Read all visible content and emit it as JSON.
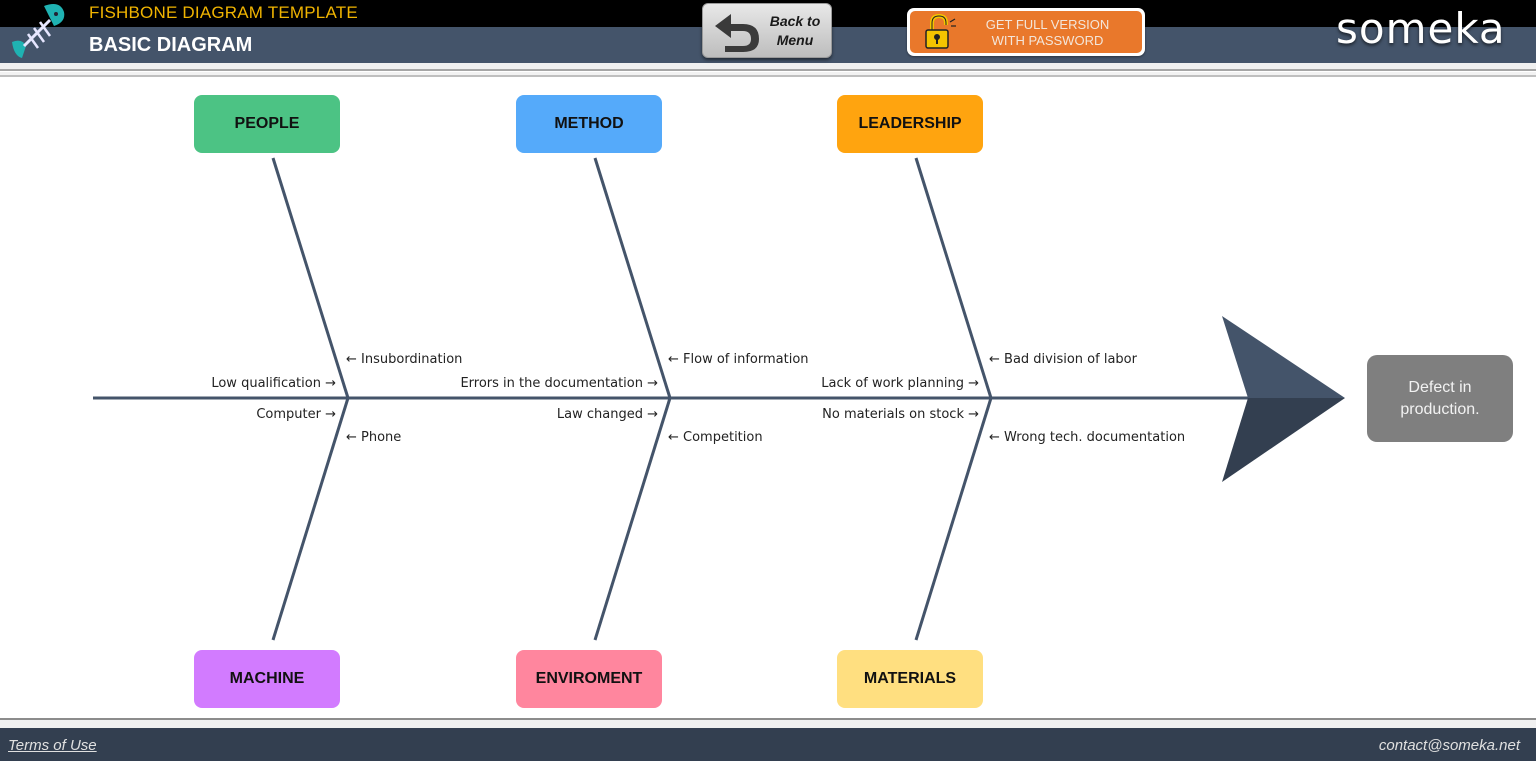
{
  "header": {
    "app_title": "FISHBONE DIAGRAM TEMPLATE",
    "page_title": "BASIC DIAGRAM",
    "logo_icon": "fishbone-icon",
    "back_button": {
      "label_line1": "Back to",
      "label_line2": "Menu",
      "icon": "back-arrow-icon"
    },
    "full_version_button": {
      "label_line1": "GET FULL VERSION",
      "label_line2": "WITH PASSWORD",
      "icon": "unlocked-padlock-icon"
    },
    "brand": "someka"
  },
  "diagram": {
    "effect": "Defect in production.",
    "categories": [
      {
        "id": "people",
        "label": "PEOPLE",
        "position": "top",
        "color": "#4cc384",
        "causes_left": [
          "Low qualification →"
        ],
        "causes_right": [
          "← Insubordination"
        ]
      },
      {
        "id": "method",
        "label": "METHOD",
        "position": "top",
        "color": "#55aafa",
        "causes_left": [
          "Errors in the documentation  →"
        ],
        "causes_right": [
          "← Flow of information"
        ]
      },
      {
        "id": "leadership",
        "label": "LEADERSHIP",
        "position": "top",
        "color": "#ffa40f",
        "causes_left": [
          "Lack of work planning →"
        ],
        "causes_right": [
          "← Bad division of labor"
        ]
      },
      {
        "id": "machine",
        "label": "MACHINE",
        "position": "bottom",
        "color": "#d27bff",
        "causes_left": [
          "Computer →"
        ],
        "causes_right": [
          "← Phone"
        ]
      },
      {
        "id": "enviroment",
        "label": "ENVIROMENT",
        "position": "bottom",
        "color": "#ff869e",
        "causes_left": [
          "Law changed →"
        ],
        "causes_right": [
          "← Competition"
        ]
      },
      {
        "id": "materials",
        "label": "MATERIALS",
        "position": "bottom",
        "color": "#ffdf80",
        "causes_left": [
          "No materials on stock →"
        ],
        "causes_right": [
          "← Wrong  tech. documentation"
        ]
      }
    ],
    "colors": {
      "bone": "#44546a",
      "head_top": "#44546a",
      "head_bottom": "#333f50",
      "effect_box": "#7f7f7f"
    }
  },
  "footer": {
    "terms_link": "Terms of Use",
    "contact": "contact@someka.net"
  }
}
